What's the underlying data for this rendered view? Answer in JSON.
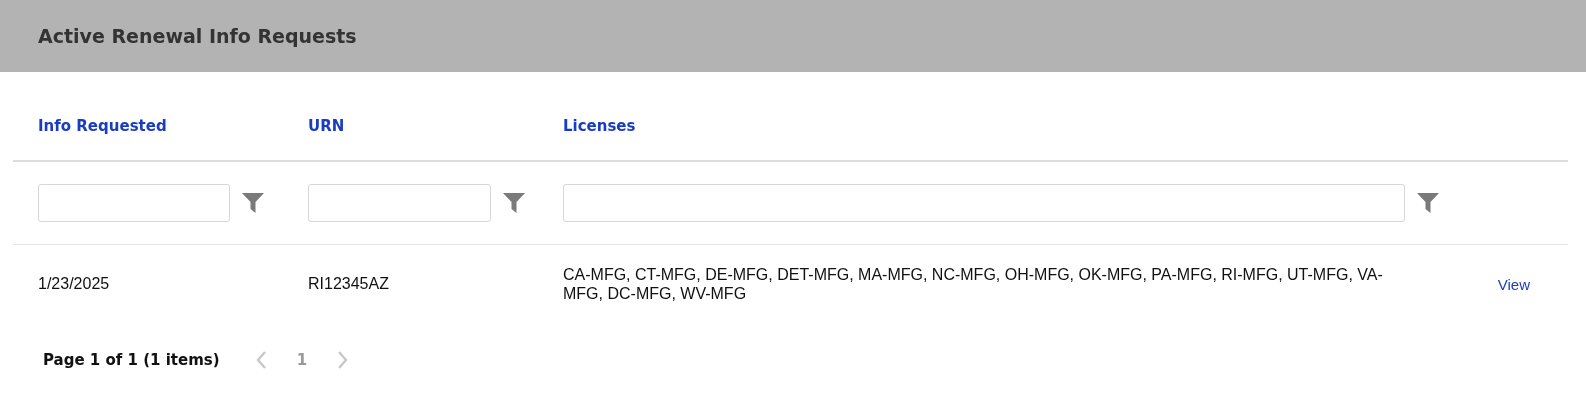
{
  "header": {
    "title": "Active Renewal Info Requests"
  },
  "table": {
    "columns": [
      {
        "label": "Info Requested"
      },
      {
        "label": "URN"
      },
      {
        "label": "Licenses"
      }
    ],
    "rows": [
      {
        "info_requested": "1/23/2025",
        "urn": "RI12345AZ",
        "licenses": "CA-MFG, CT-MFG, DE-MFG, DET-MFG, MA-MFG, NC-MFG, OH-MFG, OK-MFG, PA-MFG, RI-MFG, UT-MFG, VA-MFG, DC-MFG, WV-MFG",
        "action": "View"
      }
    ]
  },
  "pager": {
    "summary": "Page 1 of 1 (1 items)",
    "prev": {
      "disabled": true
    },
    "next": {
      "disabled": true
    },
    "pages": [
      {
        "label": "1",
        "selected": true
      }
    ]
  }
}
